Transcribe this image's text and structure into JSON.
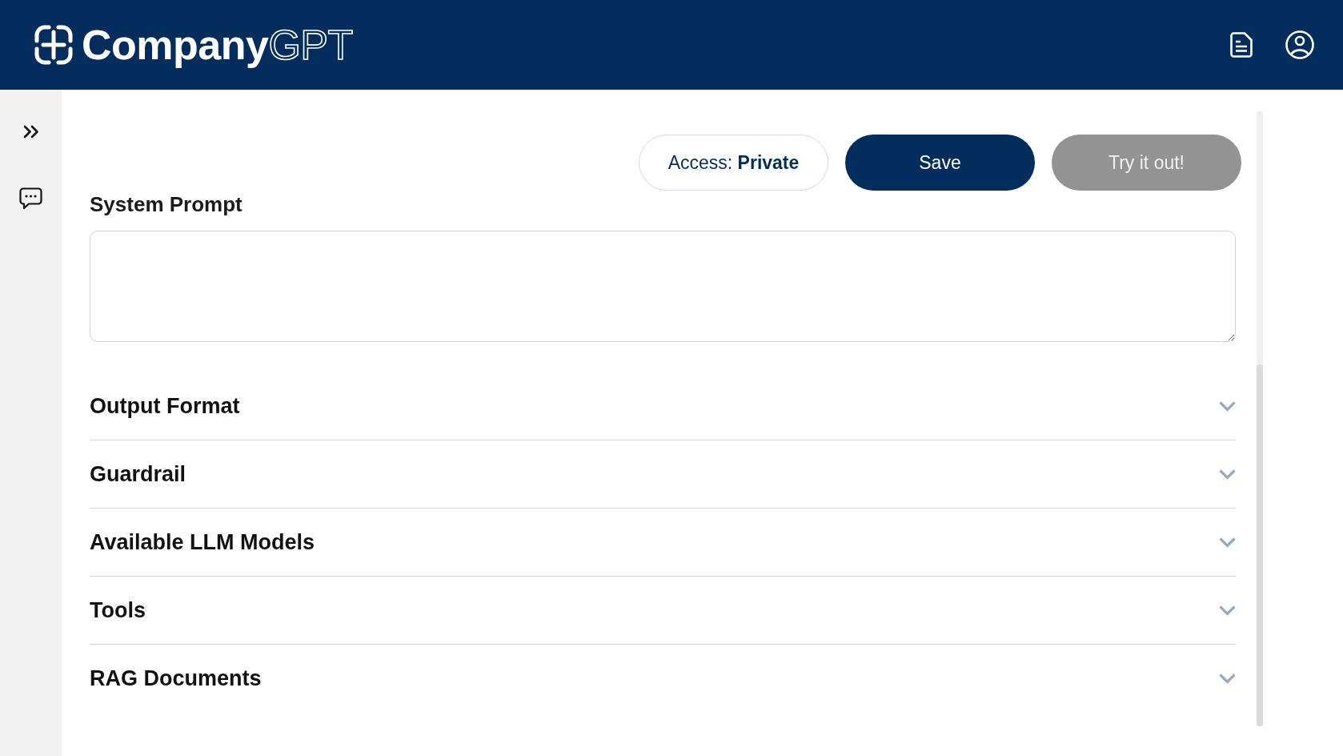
{
  "header": {
    "logo": {
      "name": "Company",
      "suffix": "GPT"
    }
  },
  "toolbar": {
    "access": {
      "label": "Access:",
      "value": "Private"
    },
    "buttons": [
      {
        "label": "Save",
        "disabled": false
      },
      {
        "label": "Try it out!",
        "disabled": true
      }
    ]
  },
  "system_prompt": {
    "label": "System Prompt"
  },
  "sections": [
    {
      "title": "Output Format",
      "expanded": false
    },
    {
      "title": "Guardrail",
      "expanded": false
    },
    {
      "title": "Available LLM Models",
      "expanded": false
    },
    {
      "title": "Tools",
      "expanded": false
    },
    {
      "title": "RAG Documents",
      "expanded": false
    }
  ]
}
